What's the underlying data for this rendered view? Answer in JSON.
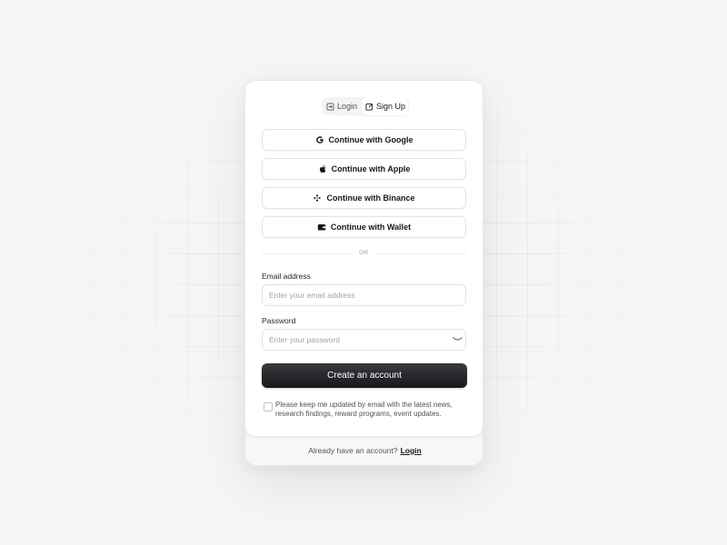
{
  "tabs": {
    "login": "Login",
    "signup": "Sign Up",
    "active": "Sign Up"
  },
  "oauth": {
    "google": {
      "label": "Continue with Google",
      "icon": "google-icon"
    },
    "apple": {
      "label": "Continue with Apple",
      "icon": "apple-icon"
    },
    "binance": {
      "label": "Continue with Binance",
      "icon": "binance-icon"
    },
    "wallet": {
      "label": "Continue with Wallet",
      "icon": "wallet-icon"
    }
  },
  "divider_text": "OR",
  "email": {
    "label": "Email address",
    "placeholder": "Enter your email address",
    "value": ""
  },
  "password": {
    "label": "Password",
    "placeholder": "Enter your password",
    "value": "",
    "toggle_icon": "eye-closed-icon"
  },
  "submit_label": "Create an account",
  "consent": {
    "text": "Please keep me updated by email with the latest news, research findings, reward programs, event updates.",
    "checked": false
  },
  "footer": {
    "text": "Already have an account?",
    "link": "Login"
  },
  "colors": {
    "primary": "#18181b",
    "background": "#f5f5f6",
    "card": "#ffffff",
    "border": "#e4e4e7"
  }
}
